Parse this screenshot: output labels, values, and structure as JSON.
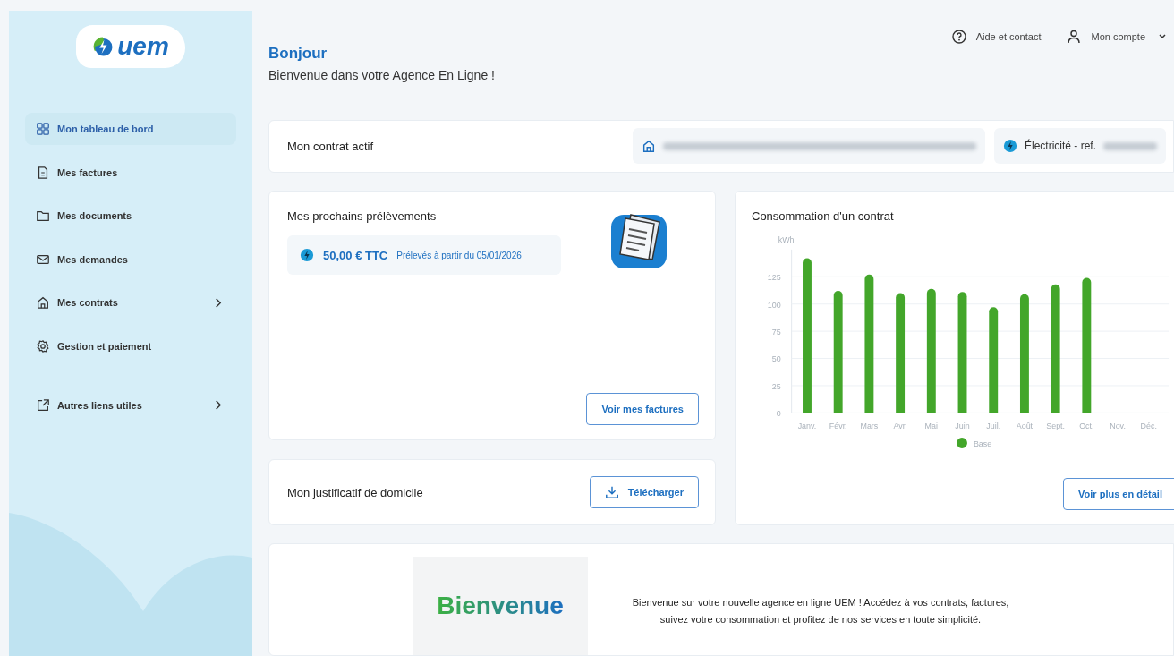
{
  "sidebar": {
    "logo_text": "uem",
    "items": [
      {
        "label": "Mon tableau de bord",
        "selected": true,
        "has_submenu": false
      },
      {
        "label": "Mes factures",
        "selected": false,
        "has_submenu": false
      },
      {
        "label": "Mes documents",
        "selected": false,
        "has_submenu": false
      },
      {
        "label": "Mes demandes",
        "selected": false,
        "has_submenu": false
      },
      {
        "label": "Mes contrats",
        "selected": false,
        "has_submenu": true
      },
      {
        "label": "Gestion et paiement",
        "selected": false,
        "has_submenu": false
      }
    ],
    "extra_items": [
      {
        "label": "Autres liens utiles",
        "selected": false,
        "has_submenu": true
      }
    ]
  },
  "header": {
    "greeting": "Bonjour",
    "subtitle": "Bienvenue dans votre Agence En Ligne !",
    "links": [
      {
        "label": "Aide et contact"
      },
      {
        "label": "Mon compte"
      }
    ]
  },
  "active_contract": {
    "title": "Mon contrat actif",
    "energy_label": "Électricité - ref."
  },
  "upcoming_debits": {
    "title": "Mes prochains prélèvements",
    "amount": "50,00 € TTC",
    "date_text": "Prélevés à partir du 05/01/2026",
    "button": "Voir mes factures"
  },
  "proof_of_address": {
    "title": "Mon justificatif de domicile",
    "button": "Télécharger"
  },
  "consumption": {
    "title": "Consommation d'un contrat",
    "button": "Voir plus en détail",
    "chart_data": {
      "type": "bar",
      "ylabel": "kWh",
      "categories": [
        "Janv.",
        "Févr.",
        "Mars",
        "Avr.",
        "Mai",
        "Juin",
        "Juil.",
        "Août",
        "Sept.",
        "Oct.",
        "Nov.",
        "Déc."
      ],
      "series": [
        {
          "name": "Base",
          "color": "#43a62a",
          "values": [
            142,
            112,
            127,
            110,
            114,
            111,
            97,
            109,
            118,
            124,
            null,
            null
          ]
        }
      ],
      "grid": true,
      "ylim": [
        0,
        150
      ],
      "yticks": [
        0,
        25,
        50,
        75,
        100,
        125
      ]
    }
  },
  "welcome": {
    "banner_text": "Bienvenue",
    "description": "Bienvenue sur votre nouvelle agence en ligne UEM ! Accédez à vos contrats, factures, suivez votre consommation et profitez de nos services en toute simplicité."
  }
}
